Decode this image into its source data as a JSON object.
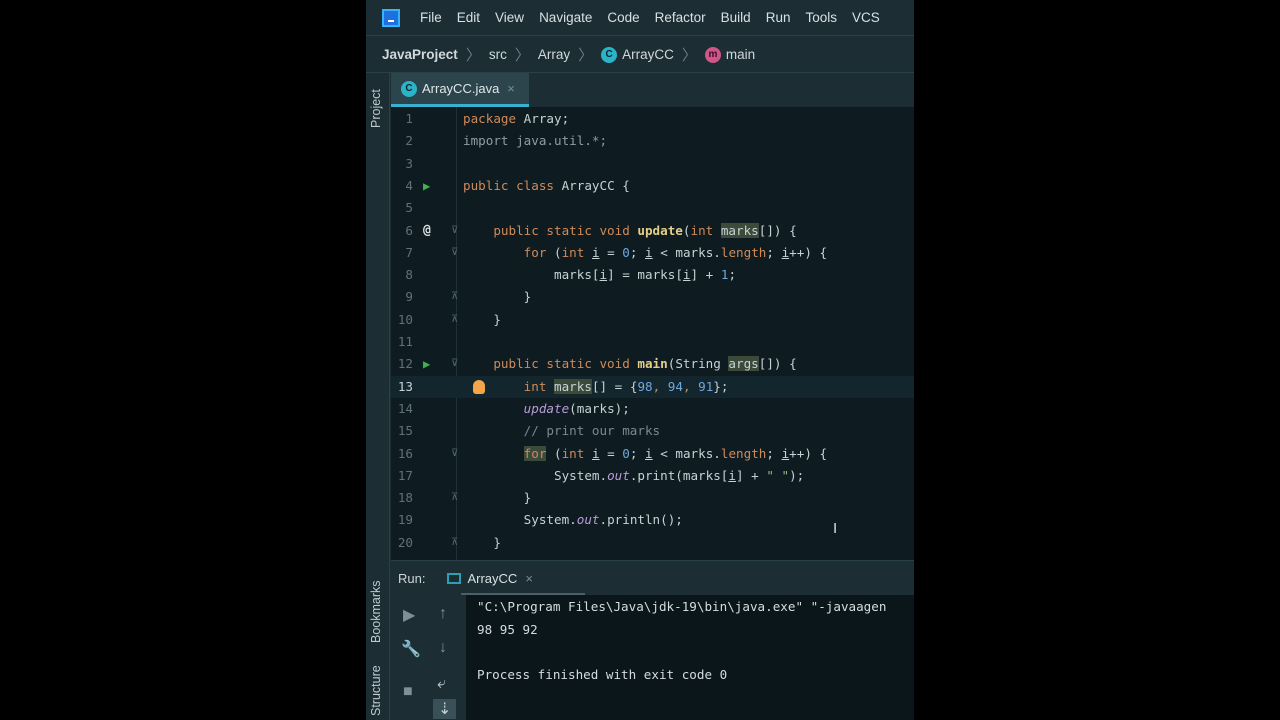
{
  "menu": [
    "File",
    "Edit",
    "View",
    "Navigate",
    "Code",
    "Refactor",
    "Build",
    "Run",
    "Tools",
    "VCS"
  ],
  "breadcrumb": {
    "project": "JavaProject",
    "src": "src",
    "package": "Array",
    "class": "ArrayCC",
    "method": "main",
    "class_icon": "C",
    "method_icon": "m"
  },
  "side": {
    "project": "Project",
    "bookmarks": "Bookmarks",
    "structure": "Structure"
  },
  "tab": {
    "label": "ArrayCC.java",
    "icon": "C",
    "close": "×"
  },
  "editor": {
    "current_line": 13,
    "lines": [
      {
        "n": "1",
        "t": [
          [
            "package ",
            "kw"
          ],
          [
            "Array;",
            ""
          ]
        ]
      },
      {
        "n": "2",
        "t": [
          [
            "import java.util.*;",
            "dim"
          ]
        ]
      },
      {
        "n": "3",
        "t": []
      },
      {
        "n": "4",
        "g": "run",
        "t": [
          [
            "public class ",
            "kw"
          ],
          [
            "ArrayCC {",
            ""
          ]
        ]
      },
      {
        "n": "5",
        "t": []
      },
      {
        "n": "6",
        "g": "@",
        "f": "open",
        "t": [
          [
            "    public static void ",
            "kw"
          ],
          [
            "update",
            "fn"
          ],
          [
            "(",
            ""
          ],
          [
            "int ",
            "kw"
          ],
          [
            "marks",
            "hl"
          ],
          [
            "[]) {",
            ""
          ]
        ]
      },
      {
        "n": "7",
        "f": "open",
        "t": [
          [
            "        for ",
            "kw"
          ],
          [
            "(",
            ""
          ],
          [
            "int ",
            "kw"
          ],
          [
            "i",
            "und"
          ],
          [
            " = ",
            ""
          ],
          [
            "0",
            "num"
          ],
          [
            "; ",
            ""
          ],
          [
            "i",
            "und"
          ],
          [
            " < marks.",
            ""
          ],
          [
            "length",
            "kw"
          ],
          [
            "; ",
            ""
          ],
          [
            "i",
            "und"
          ],
          [
            "++) {",
            ""
          ]
        ]
      },
      {
        "n": "8",
        "t": [
          [
            "            marks[",
            ""
          ],
          [
            "i",
            "und"
          ],
          [
            "] = marks[",
            ""
          ],
          [
            "i",
            "und"
          ],
          [
            "] + ",
            ""
          ],
          [
            "1",
            "num"
          ],
          [
            ";",
            ""
          ]
        ]
      },
      {
        "n": "9",
        "f": "close",
        "t": [
          [
            "        }",
            ""
          ]
        ]
      },
      {
        "n": "10",
        "f": "close",
        "t": [
          [
            "    }",
            ""
          ]
        ]
      },
      {
        "n": "11",
        "t": []
      },
      {
        "n": "12",
        "g": "run",
        "f": "open",
        "t": [
          [
            "    public static void ",
            "kw"
          ],
          [
            "main",
            "fn"
          ],
          [
            "(String ",
            ""
          ],
          [
            "args",
            "hl"
          ],
          [
            "[]) {",
            ""
          ]
        ]
      },
      {
        "n": "13",
        "bulb": true,
        "t": [
          [
            "        ",
            ""
          ],
          [
            "int ",
            "kw"
          ],
          [
            "marks",
            "hl"
          ],
          [
            "[] = {",
            ""
          ],
          [
            "98",
            "num"
          ],
          [
            ", ",
            "kw"
          ],
          [
            "94",
            "num"
          ],
          [
            ", ",
            "kw"
          ],
          [
            "91",
            "num"
          ],
          [
            "};",
            ""
          ]
        ]
      },
      {
        "n": "14",
        "t": [
          [
            "        ",
            ""
          ],
          [
            "update",
            "it"
          ],
          [
            "(marks);",
            ""
          ]
        ]
      },
      {
        "n": "15",
        "t": [
          [
            "        // print our marks",
            "cm"
          ]
        ]
      },
      {
        "n": "16",
        "f": "open",
        "t": [
          [
            "        ",
            ""
          ],
          [
            "for",
            "kw hl"
          ],
          [
            " (",
            ""
          ],
          [
            "int ",
            "kw"
          ],
          [
            "i",
            "und"
          ],
          [
            " = ",
            ""
          ],
          [
            "0",
            "num"
          ],
          [
            "; ",
            ""
          ],
          [
            "i",
            "und"
          ],
          [
            " < marks.",
            ""
          ],
          [
            "length",
            "kw"
          ],
          [
            "; ",
            ""
          ],
          [
            "i",
            "und"
          ],
          [
            "++) {",
            ""
          ]
        ]
      },
      {
        "n": "17",
        "t": [
          [
            "            System.",
            ""
          ],
          [
            "out",
            "it"
          ],
          [
            ".print(marks[",
            ""
          ],
          [
            "i",
            "und"
          ],
          [
            "] + ",
            ""
          ],
          [
            "\" \"",
            "str"
          ],
          [
            ");",
            ""
          ]
        ]
      },
      {
        "n": "18",
        "f": "close",
        "t": [
          [
            "        }",
            ""
          ]
        ]
      },
      {
        "n": "19",
        "t": [
          [
            "        System.",
            ""
          ],
          [
            "out",
            "it"
          ],
          [
            ".println();",
            ""
          ]
        ]
      },
      {
        "n": "20",
        "f": "close",
        "t": [
          [
            "    }",
            ""
          ]
        ]
      }
    ]
  },
  "run": {
    "label": "Run:",
    "tab": "ArrayCC",
    "close": "×"
  },
  "console": {
    "lines": [
      "\"C:\\Program Files\\Java\\jdk-19\\bin\\java.exe\" \"-javaagen",
      "98 95 92",
      "",
      "Process finished with exit code 0"
    ]
  }
}
